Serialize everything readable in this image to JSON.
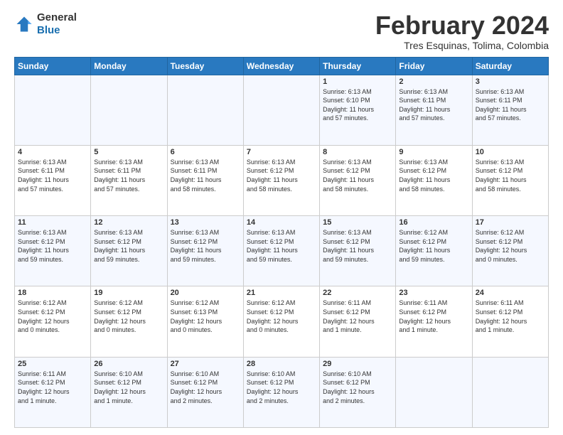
{
  "header": {
    "logo": {
      "line1": "General",
      "line2": "Blue"
    },
    "title": "February 2024",
    "subtitle": "Tres Esquinas, Tolima, Colombia"
  },
  "weekdays": [
    "Sunday",
    "Monday",
    "Tuesday",
    "Wednesday",
    "Thursday",
    "Friday",
    "Saturday"
  ],
  "weeks": [
    [
      {
        "day": "",
        "info": ""
      },
      {
        "day": "",
        "info": ""
      },
      {
        "day": "",
        "info": ""
      },
      {
        "day": "",
        "info": ""
      },
      {
        "day": "1",
        "info": "Sunrise: 6:13 AM\nSunset: 6:10 PM\nDaylight: 11 hours\nand 57 minutes."
      },
      {
        "day": "2",
        "info": "Sunrise: 6:13 AM\nSunset: 6:11 PM\nDaylight: 11 hours\nand 57 minutes."
      },
      {
        "day": "3",
        "info": "Sunrise: 6:13 AM\nSunset: 6:11 PM\nDaylight: 11 hours\nand 57 minutes."
      }
    ],
    [
      {
        "day": "4",
        "info": "Sunrise: 6:13 AM\nSunset: 6:11 PM\nDaylight: 11 hours\nand 57 minutes."
      },
      {
        "day": "5",
        "info": "Sunrise: 6:13 AM\nSunset: 6:11 PM\nDaylight: 11 hours\nand 57 minutes."
      },
      {
        "day": "6",
        "info": "Sunrise: 6:13 AM\nSunset: 6:11 PM\nDaylight: 11 hours\nand 58 minutes."
      },
      {
        "day": "7",
        "info": "Sunrise: 6:13 AM\nSunset: 6:12 PM\nDaylight: 11 hours\nand 58 minutes."
      },
      {
        "day": "8",
        "info": "Sunrise: 6:13 AM\nSunset: 6:12 PM\nDaylight: 11 hours\nand 58 minutes."
      },
      {
        "day": "9",
        "info": "Sunrise: 6:13 AM\nSunset: 6:12 PM\nDaylight: 11 hours\nand 58 minutes."
      },
      {
        "day": "10",
        "info": "Sunrise: 6:13 AM\nSunset: 6:12 PM\nDaylight: 11 hours\nand 58 minutes."
      }
    ],
    [
      {
        "day": "11",
        "info": "Sunrise: 6:13 AM\nSunset: 6:12 PM\nDaylight: 11 hours\nand 59 minutes."
      },
      {
        "day": "12",
        "info": "Sunrise: 6:13 AM\nSunset: 6:12 PM\nDaylight: 11 hours\nand 59 minutes."
      },
      {
        "day": "13",
        "info": "Sunrise: 6:13 AM\nSunset: 6:12 PM\nDaylight: 11 hours\nand 59 minutes."
      },
      {
        "day": "14",
        "info": "Sunrise: 6:13 AM\nSunset: 6:12 PM\nDaylight: 11 hours\nand 59 minutes."
      },
      {
        "day": "15",
        "info": "Sunrise: 6:13 AM\nSunset: 6:12 PM\nDaylight: 11 hours\nand 59 minutes."
      },
      {
        "day": "16",
        "info": "Sunrise: 6:12 AM\nSunset: 6:12 PM\nDaylight: 11 hours\nand 59 minutes."
      },
      {
        "day": "17",
        "info": "Sunrise: 6:12 AM\nSunset: 6:12 PM\nDaylight: 12 hours\nand 0 minutes."
      }
    ],
    [
      {
        "day": "18",
        "info": "Sunrise: 6:12 AM\nSunset: 6:12 PM\nDaylight: 12 hours\nand 0 minutes."
      },
      {
        "day": "19",
        "info": "Sunrise: 6:12 AM\nSunset: 6:12 PM\nDaylight: 12 hours\nand 0 minutes."
      },
      {
        "day": "20",
        "info": "Sunrise: 6:12 AM\nSunset: 6:13 PM\nDaylight: 12 hours\nand 0 minutes."
      },
      {
        "day": "21",
        "info": "Sunrise: 6:12 AM\nSunset: 6:12 PM\nDaylight: 12 hours\nand 0 minutes."
      },
      {
        "day": "22",
        "info": "Sunrise: 6:11 AM\nSunset: 6:12 PM\nDaylight: 12 hours\nand 1 minute."
      },
      {
        "day": "23",
        "info": "Sunrise: 6:11 AM\nSunset: 6:12 PM\nDaylight: 12 hours\nand 1 minute."
      },
      {
        "day": "24",
        "info": "Sunrise: 6:11 AM\nSunset: 6:12 PM\nDaylight: 12 hours\nand 1 minute."
      }
    ],
    [
      {
        "day": "25",
        "info": "Sunrise: 6:11 AM\nSunset: 6:12 PM\nDaylight: 12 hours\nand 1 minute."
      },
      {
        "day": "26",
        "info": "Sunrise: 6:10 AM\nSunset: 6:12 PM\nDaylight: 12 hours\nand 1 minute."
      },
      {
        "day": "27",
        "info": "Sunrise: 6:10 AM\nSunset: 6:12 PM\nDaylight: 12 hours\nand 2 minutes."
      },
      {
        "day": "28",
        "info": "Sunrise: 6:10 AM\nSunset: 6:12 PM\nDaylight: 12 hours\nand 2 minutes."
      },
      {
        "day": "29",
        "info": "Sunrise: 6:10 AM\nSunset: 6:12 PM\nDaylight: 12 hours\nand 2 minutes."
      },
      {
        "day": "",
        "info": ""
      },
      {
        "day": "",
        "info": ""
      }
    ]
  ]
}
